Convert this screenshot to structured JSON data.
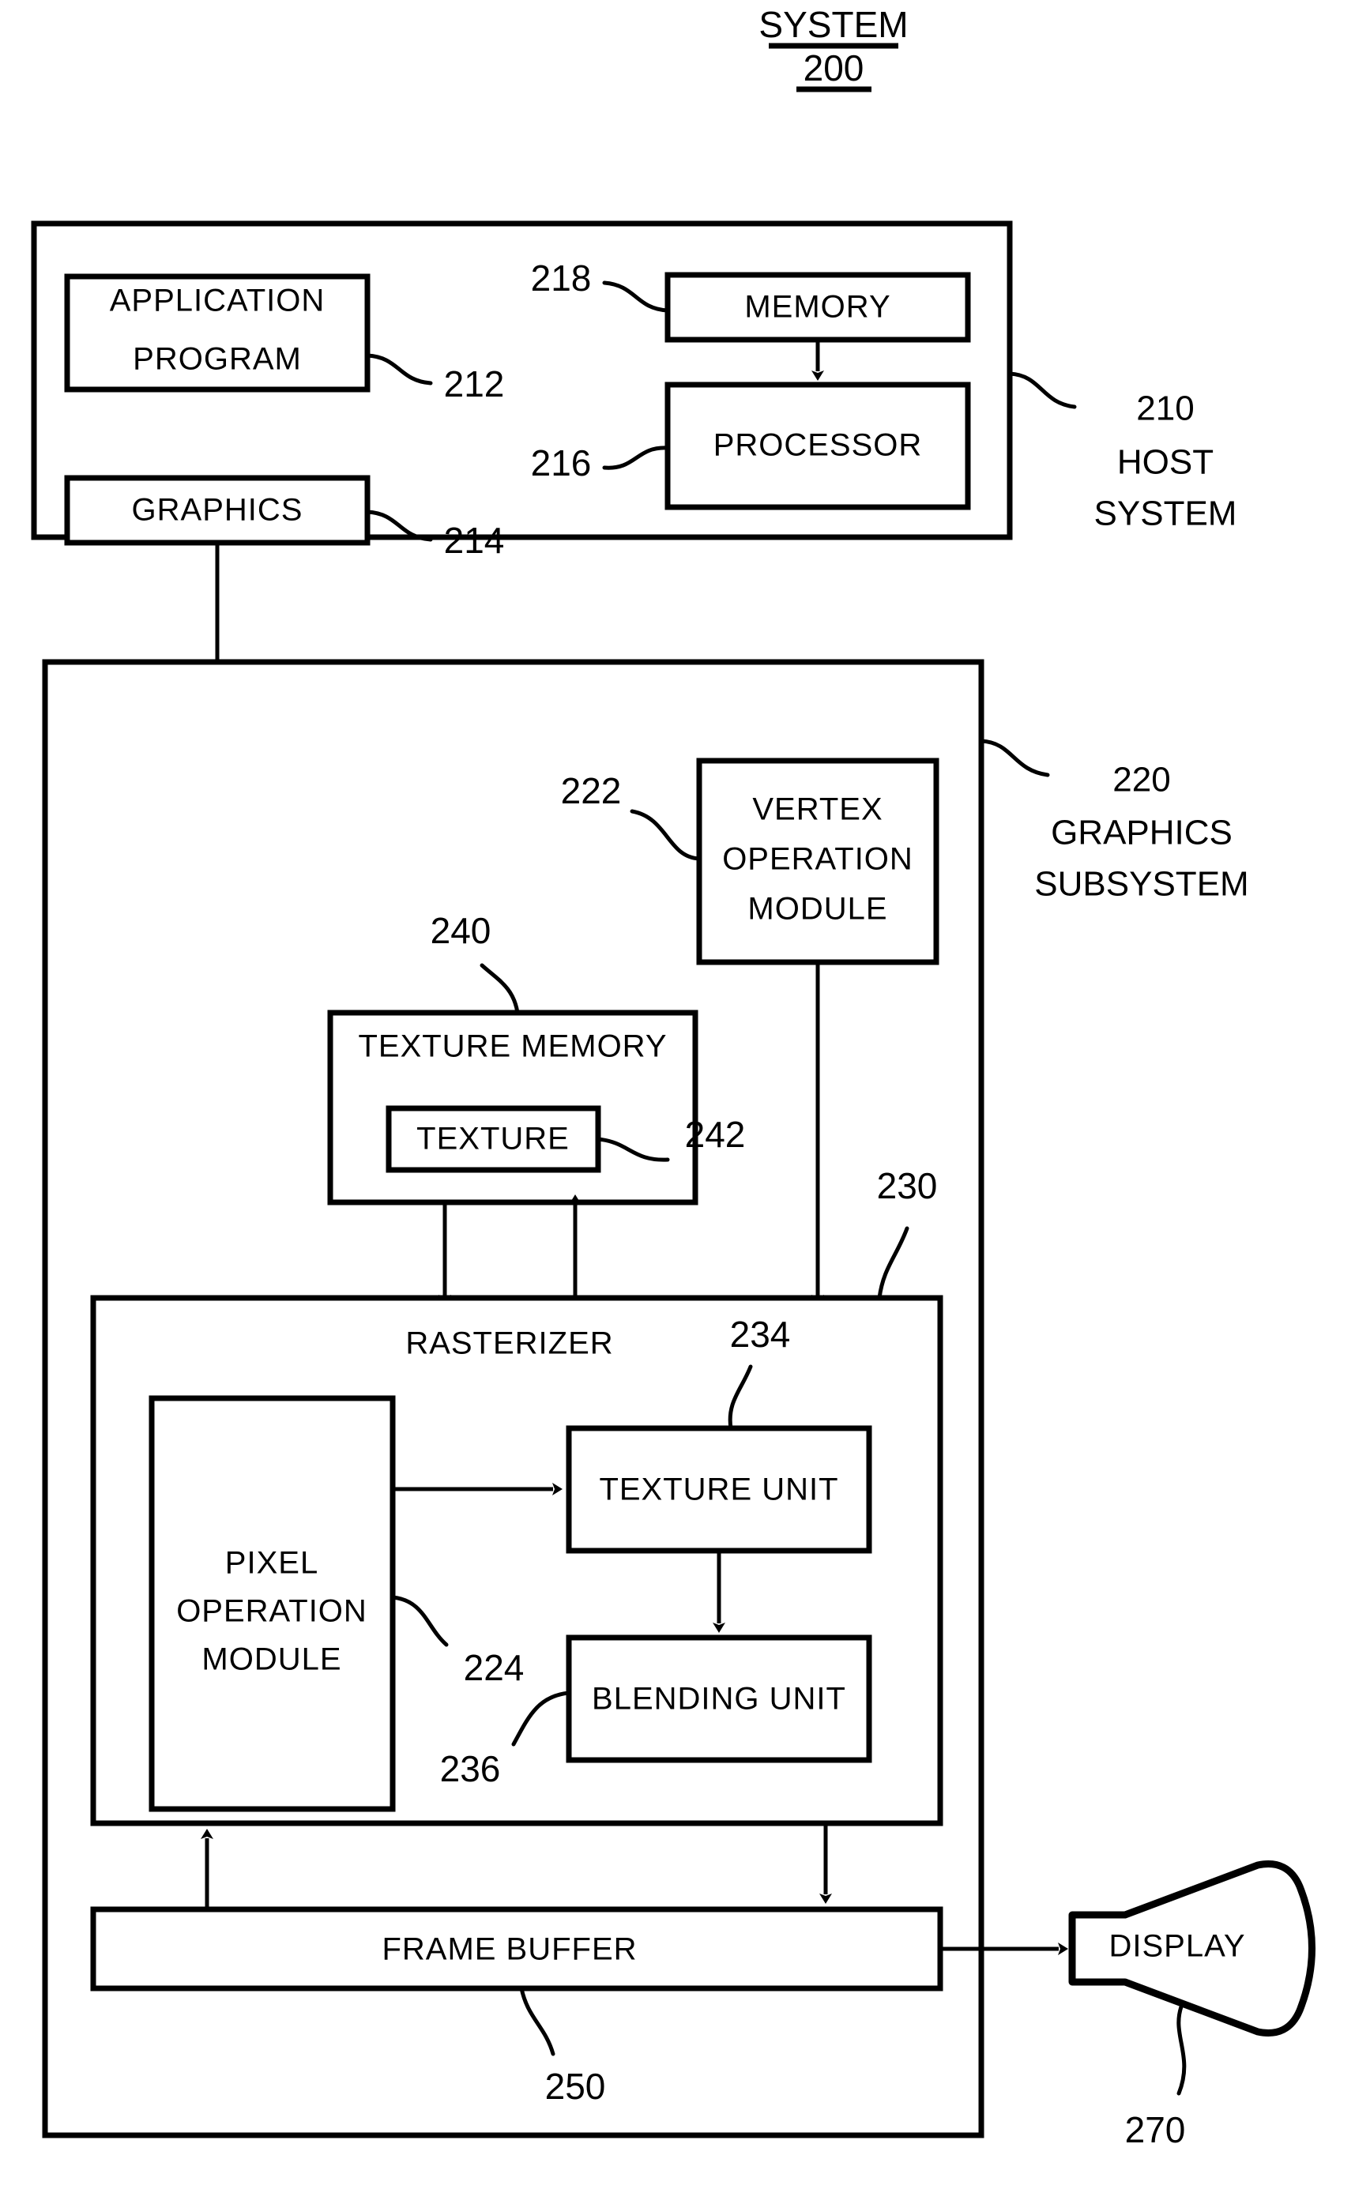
{
  "figure": {
    "title_line1": "SYSTEM",
    "title_line2": "200"
  },
  "host_system": {
    "ref": "210",
    "label_line1": "HOST",
    "label_line2": "SYSTEM",
    "blocks": [
      {
        "name": "application-program",
        "ref": "212",
        "line1": "APPLICATION",
        "line2": "PROGRAM"
      },
      {
        "name": "graphics",
        "ref": "214",
        "line1": "GRAPHICS",
        "line2": ""
      },
      {
        "name": "processor",
        "ref": "216",
        "line1": "PROCESSOR",
        "line2": ""
      },
      {
        "name": "memory",
        "ref": "218",
        "line1": "MEMORY",
        "line2": ""
      }
    ]
  },
  "graphics_subsystem": {
    "ref": "220",
    "label_line1": "GRAPHICS",
    "label_line2": "SUBSYSTEM",
    "blocks": [
      {
        "name": "vertex-operation-module",
        "ref": "222",
        "line1": "VERTEX",
        "line2": "OPERATION",
        "line3": "MODULE"
      },
      {
        "name": "texture-memory",
        "ref": "240",
        "line1": "TEXTURE MEMORY"
      },
      {
        "name": "texture",
        "ref": "242",
        "line1": "TEXTURE"
      },
      {
        "name": "rasterizer",
        "ref": "230",
        "line1": "RASTERIZER"
      },
      {
        "name": "pixel-operation-module",
        "ref": "224",
        "line1": "PIXEL",
        "line2": "OPERATION",
        "line3": "MODULE"
      },
      {
        "name": "texture-unit",
        "ref": "234",
        "line1": "TEXTURE  UNIT"
      },
      {
        "name": "blending-unit",
        "ref": "236",
        "line1": "BLENDING  UNIT"
      },
      {
        "name": "frame-buffer",
        "ref": "250",
        "line1": "FRAME  BUFFER"
      }
    ]
  },
  "display": {
    "name": "display",
    "ref": "270",
    "label": "DISPLAY"
  }
}
